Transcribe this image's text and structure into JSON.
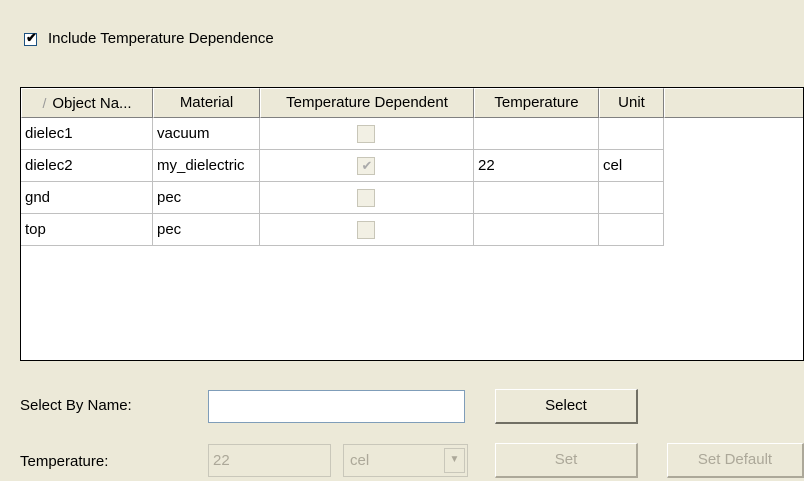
{
  "include_temp": {
    "label": "Include Temperature Dependence",
    "checked": true
  },
  "grid": {
    "columns": [
      {
        "label": "Object Na...",
        "sort_icon": "/"
      },
      {
        "label": "Material"
      },
      {
        "label": "Temperature Dependent"
      },
      {
        "label": "Temperature"
      },
      {
        "label": "Unit"
      }
    ],
    "rows": [
      {
        "object": "dielec1",
        "material": "vacuum",
        "temp_dependent": false,
        "temperature": "",
        "unit": ""
      },
      {
        "object": "dielec2",
        "material": "my_dielectric",
        "temp_dependent": true,
        "temperature": "22",
        "unit": "cel"
      },
      {
        "object": "gnd",
        "material": "pec",
        "temp_dependent": false,
        "temperature": "",
        "unit": ""
      },
      {
        "object": "top",
        "material": "pec",
        "temp_dependent": false,
        "temperature": "",
        "unit": ""
      }
    ]
  },
  "select_by_name": {
    "label": "Select By Name:",
    "value": "",
    "button": "Select"
  },
  "temperature": {
    "label": "Temperature:",
    "value": "22",
    "unit": "cel",
    "set_button": "Set",
    "default_button": "Set Default"
  },
  "icons": {
    "check": "✔",
    "dropdown": "▼"
  }
}
